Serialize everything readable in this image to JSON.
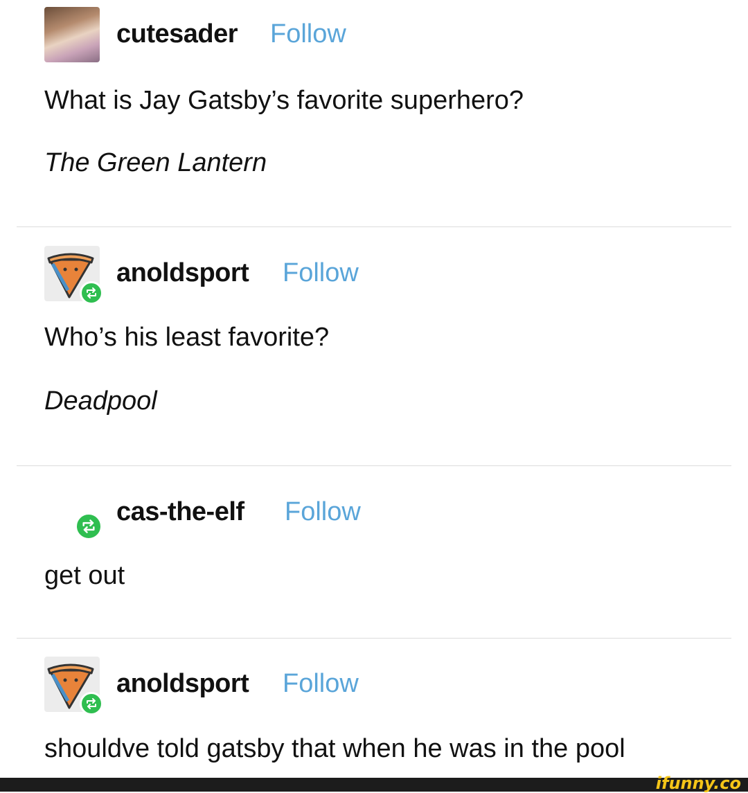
{
  "posts": [
    {
      "username": "cutesader",
      "follow_label": "Follow",
      "lines": [
        "What is Jay Gatsby’s favorite superhero?",
        "The Green Lantern"
      ]
    },
    {
      "username": "anoldsport",
      "follow_label": "Follow",
      "lines": [
        "Who’s his least favorite?",
        "Deadpool"
      ]
    },
    {
      "username": "cas-the-elf",
      "follow_label": "Follow",
      "lines": [
        "get out"
      ]
    },
    {
      "username": "anoldsport",
      "follow_label": "Follow",
      "lines": [
        "shouldve told gatsby that when he was in the pool"
      ]
    }
  ],
  "watermark": "ifunny.co",
  "colors": {
    "follow": "#5aa5d9",
    "reblog_badge": "#2fbe50",
    "divider": "#dcdcdc"
  }
}
